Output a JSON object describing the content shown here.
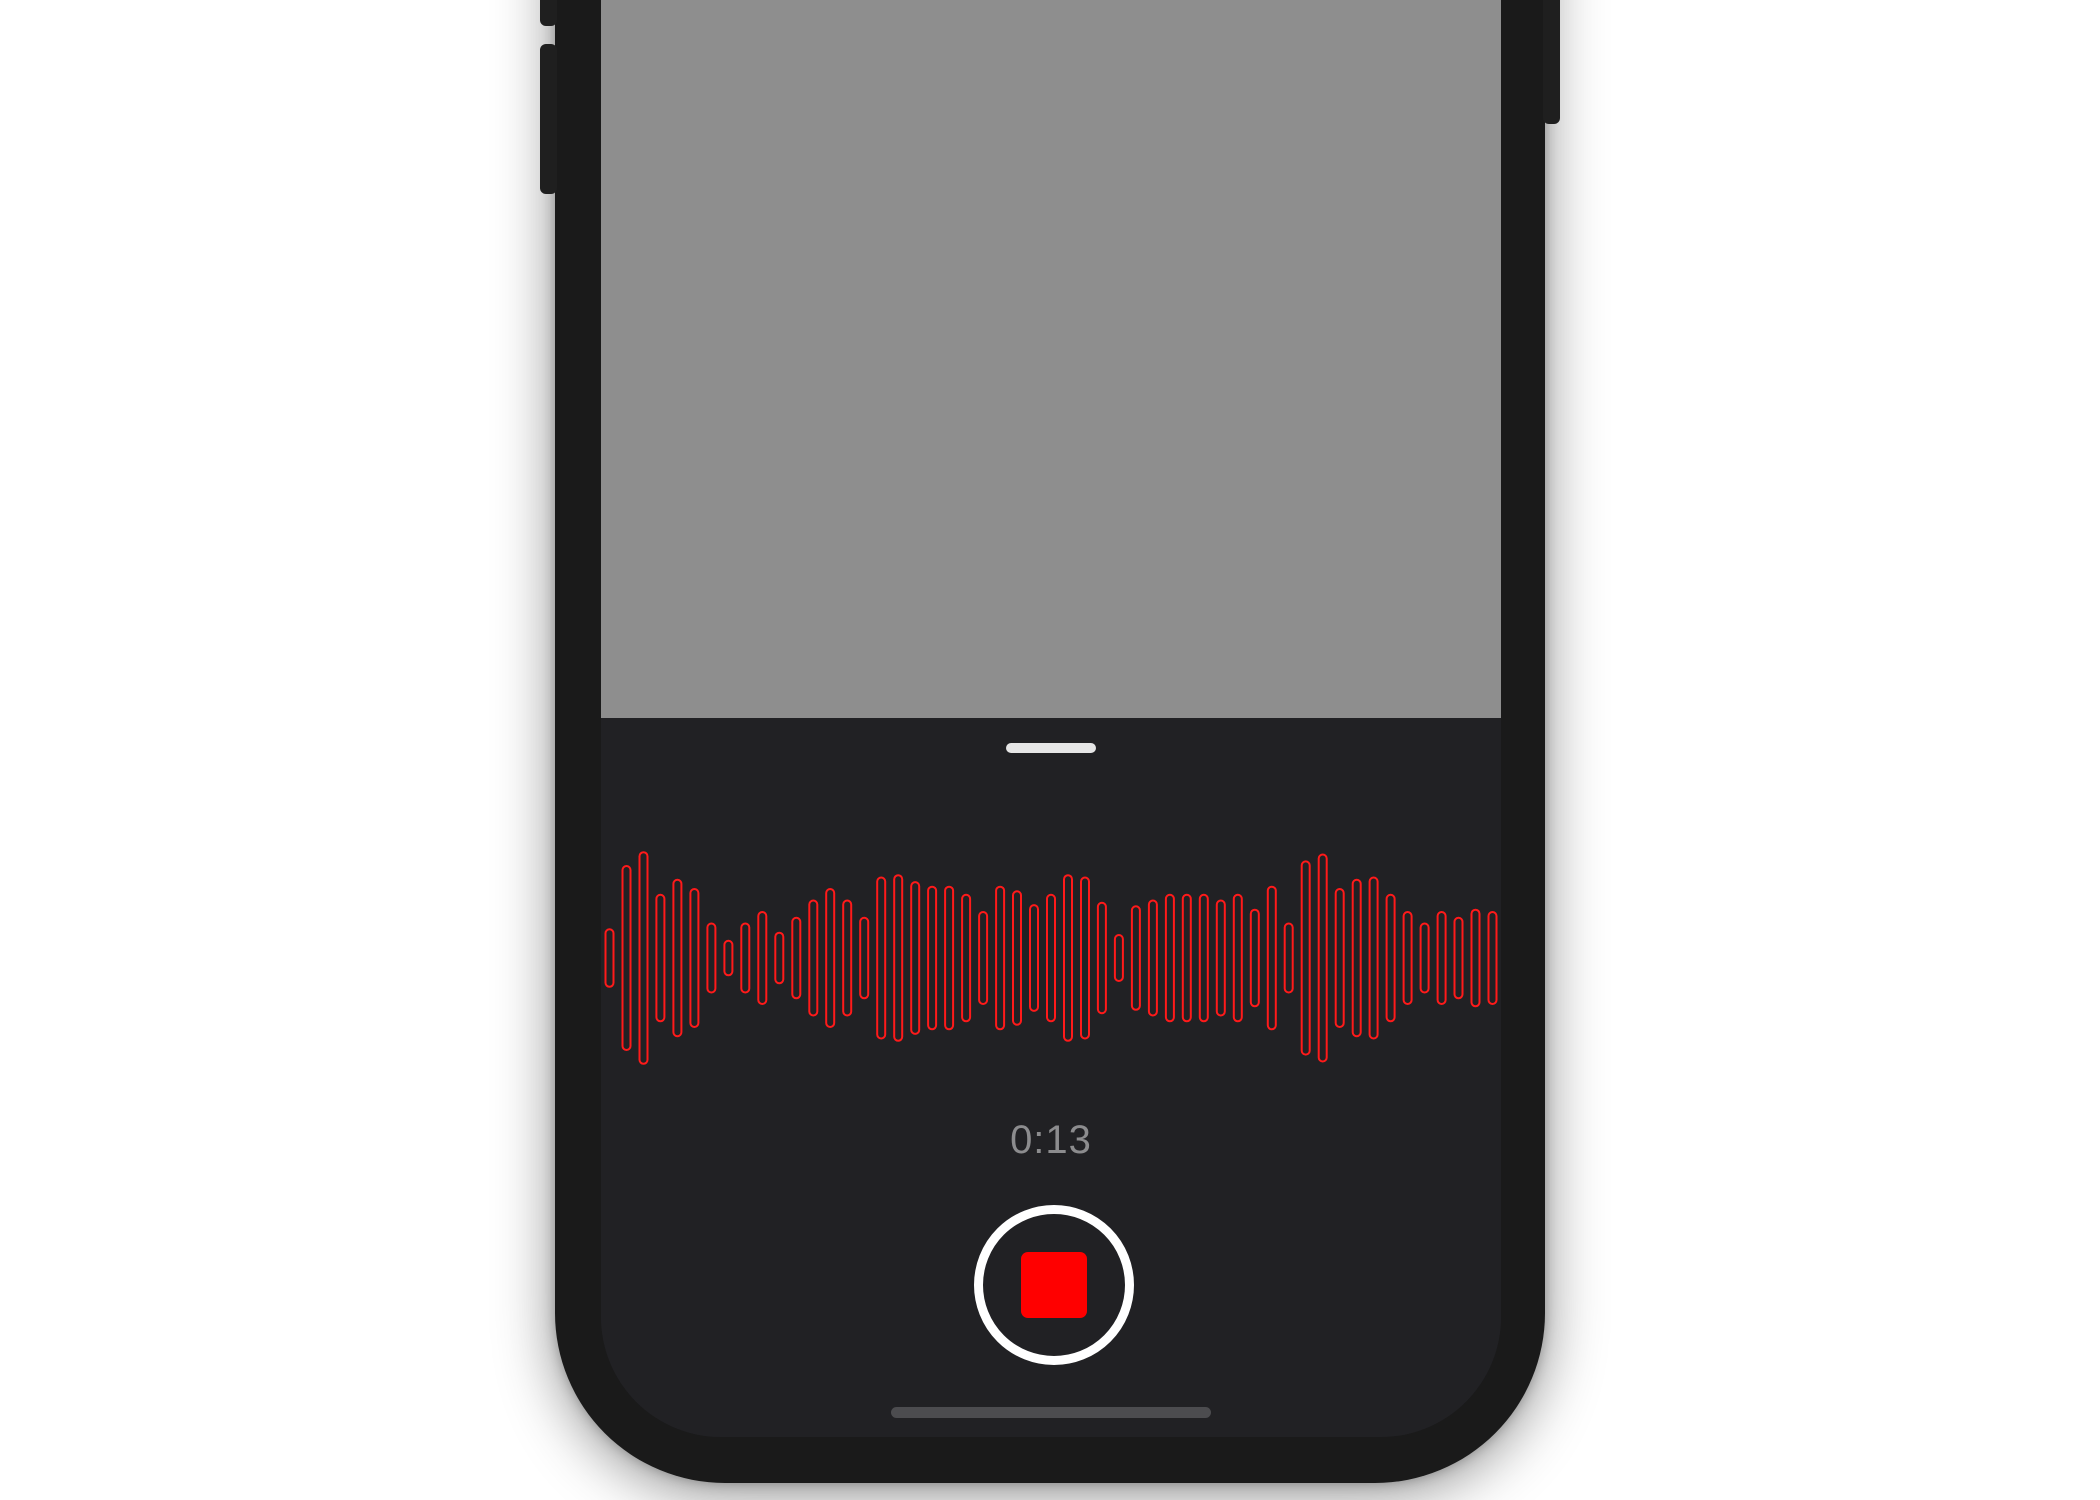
{
  "recorder": {
    "elapsed_time": "0:13",
    "state": "recording"
  },
  "colors": {
    "accent": "#ff0000",
    "waveform": "#ff1a1a",
    "sheet_background": "#212124",
    "upper_area": "#8e8e8e",
    "timer_text": "#8c8c8e",
    "button_ring": "#ffffff"
  },
  "icons": {
    "record_button": "stop-icon",
    "grabber": "sheet-grabber",
    "home": "home-indicator"
  },
  "waveform": {
    "amplitudes": [
      0.25,
      0.8,
      0.92,
      0.55,
      0.68,
      0.6,
      0.3,
      0.15,
      0.3,
      0.4,
      0.22,
      0.35,
      0.5,
      0.6,
      0.5,
      0.35,
      0.7,
      0.72,
      0.66,
      0.62,
      0.62,
      0.55,
      0.4,
      0.62,
      0.58,
      0.46,
      0.55,
      0.72,
      0.7,
      0.48,
      0.2,
      0.45,
      0.5,
      0.55,
      0.55,
      0.55,
      0.5,
      0.55,
      0.42,
      0.62,
      0.3,
      0.84,
      0.9,
      0.6,
      0.68,
      0.7,
      0.55,
      0.4,
      0.3,
      0.4,
      0.35,
      0.42,
      0.4
    ]
  }
}
